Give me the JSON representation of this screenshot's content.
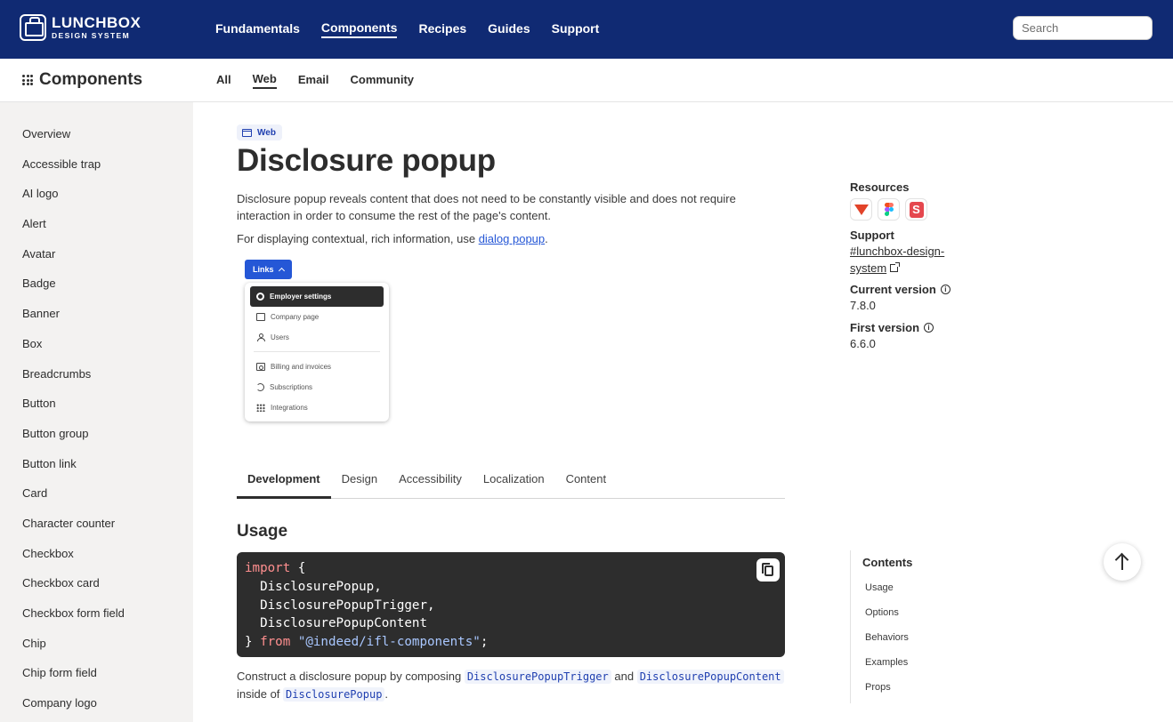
{
  "header": {
    "logo_main": "LUNCHBOX",
    "logo_sub": "DESIGN SYSTEM",
    "nav": [
      {
        "label": "Fundamentals",
        "active": false
      },
      {
        "label": "Components",
        "active": true
      },
      {
        "label": "Recipes",
        "active": false
      },
      {
        "label": "Guides",
        "active": false
      },
      {
        "label": "Support",
        "active": false
      }
    ],
    "search_placeholder": "Search",
    "bg_color": "#102a73"
  },
  "subheader": {
    "title": "Components",
    "tabs": [
      {
        "label": "All",
        "active": false
      },
      {
        "label": "Web",
        "active": true
      },
      {
        "label": "Email",
        "active": false
      },
      {
        "label": "Community",
        "active": false
      }
    ]
  },
  "sidebar": {
    "items": [
      "Overview",
      "Accessible trap",
      "AI logo",
      "Alert",
      "Avatar",
      "Badge",
      "Banner",
      "Box",
      "Breadcrumbs",
      "Button",
      "Button group",
      "Button link",
      "Card",
      "Character counter",
      "Checkbox",
      "Checkbox card",
      "Checkbox form field",
      "Chip",
      "Chip form field",
      "Company logo"
    ]
  },
  "main": {
    "badge": "Web",
    "title": "Disclosure popup",
    "description": "Disclosure popup reveals content that does not need to be constantly visible and does not require interaction in order to consume the rest of the page's content.",
    "description2_prefix": "For displaying contextual, rich information, use ",
    "description2_link": "dialog popup",
    "description2_suffix": ".",
    "preview": {
      "trigger_label": "Links",
      "items_group1": [
        {
          "label": "Employer settings",
          "icon": "gear-icon",
          "selected": true
        },
        {
          "label": "Company page",
          "icon": "card-icon",
          "selected": false
        },
        {
          "label": "Users",
          "icon": "user-icon",
          "selected": false
        }
      ],
      "items_group2": [
        {
          "label": "Billing and invoices",
          "icon": "bill-icon",
          "selected": false
        },
        {
          "label": "Subscriptions",
          "icon": "sync-icon",
          "selected": false
        },
        {
          "label": "Integrations",
          "icon": "grid-icon",
          "selected": false
        }
      ]
    },
    "tabs": [
      {
        "label": "Development",
        "active": true
      },
      {
        "label": "Design",
        "active": false
      },
      {
        "label": "Accessibility",
        "active": false
      },
      {
        "label": "Localization",
        "active": false
      },
      {
        "label": "Content",
        "active": false
      }
    ],
    "usage_heading": "Usage",
    "code": {
      "kw_import": "import",
      "open_brace": " {",
      "line1": "  DisclosurePopup,",
      "line2": "  DisclosurePopupTrigger,",
      "line3": "  DisclosurePopupContent",
      "close_brace": "} ",
      "kw_from": "from",
      "module": "\"@indeed/ifl-components\"",
      "semicolon": ";"
    },
    "construct": {
      "prefix": "Construct a disclosure popup by composing ",
      "code1": "DisclosurePopupTrigger",
      "and": " and ",
      "code2": "DisclosurePopupContent",
      "inside": " inside of ",
      "code3": "DisclosurePopup",
      "end": "."
    }
  },
  "rail": {
    "resources_label": "Resources",
    "resource_icons": [
      "gitlab-icon",
      "figma-icon",
      "storybook-icon"
    ],
    "support_label": "Support",
    "support_link_line1": "#lunchbox-design-",
    "support_link_line2": "system",
    "current_version_label": "Current version",
    "current_version": "7.8.0",
    "first_version_label": "First version",
    "first_version": "6.6.0"
  },
  "toc": {
    "heading": "Contents",
    "items": [
      "Usage",
      "Options",
      "Behaviors",
      "Examples",
      "Props"
    ]
  }
}
